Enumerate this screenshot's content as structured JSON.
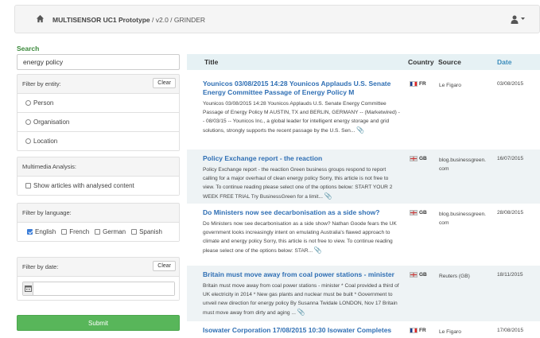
{
  "navbar": {
    "app_title": "MULTISENSOR UC1 Prototype",
    "version_path": " / v2.0 / GRINDER"
  },
  "search": {
    "label": "Search",
    "value": "energy policy",
    "submit_label": "Submit"
  },
  "filters": {
    "entity": {
      "heading": "Filter by entity:",
      "clear_label": "Clear",
      "options": [
        "Person",
        "Organisation",
        "Location"
      ]
    },
    "multimedia": {
      "heading": "Multimedia Analysis:",
      "option": "Show articles with analysed content"
    },
    "language": {
      "heading": "Filter by language:",
      "options": [
        {
          "label": "English",
          "checked": true
        },
        {
          "label": "French",
          "checked": false
        },
        {
          "label": "German",
          "checked": false
        },
        {
          "label": "Spanish",
          "checked": false
        }
      ]
    },
    "date": {
      "heading": "Filter by date:",
      "clear_label": "Clear",
      "value": ""
    }
  },
  "table": {
    "headers": {
      "title": "Title",
      "country": "Country",
      "source": "Source",
      "date": "Date"
    },
    "rows": [
      {
        "title": "Younicos 03/08/2015 14:28 Younicos Applauds U.S. Senate Energy Committee Passage of Energy Policy M",
        "snippet": "Younicos 03/08/2015 14:28 Younicos Applauds U.S. Senate Energy Committee Passage of Energy Policy M AUSTIN, TX and BERLIN, GERMANY -- (Marketwired) -- 08/03/15 -- Younicos Inc., a global leader for intelligent energy storage and grid solutions, strongly supports the recent passage by the U.S. Sen...",
        "country": "FR",
        "source": "Le Figaro",
        "date": "03/08/2015"
      },
      {
        "title": "Policy Exchange report - the reaction",
        "snippet": "Policy Exchange report - the reaction Green business groups respond to report calling for a major overhaul of clean energy policy Sorry, this article is not free to view. To continue reading please select one of the options below: START YOUR 2 WEEK FREE TRIAL Try BusinessGreen for a limit...",
        "country": "GB",
        "source": "blog.businessgreen.com",
        "date": "16/07/2015"
      },
      {
        "title": "Do Ministers now see decarbonisation as a side show?",
        "snippet": "Do Ministers now see decarbonisation as a side show? Nathan Goode fears the UK government looks increasingly intent on emulating Australia's flawed approach to climate and energy policy Sorry, this article is not free to view. To continue reading please select one of the options below: STAR...",
        "country": "GB",
        "source": "blog.businessgreen.com",
        "date": "28/08/2015"
      },
      {
        "title": "Britain must move away from coal power stations - minister",
        "snippet": "Britain must move away from coal power stations - minister * Coal provided a third of UK electricity in 2014 * New gas plants and nuclear must be built * Government to unveil new direction for energy policy By Susanna Twidale LONDON, Nov 17 Britain must move away from dirty and aging ...",
        "country": "GB",
        "source": "Reuters (GB)",
        "date": "18/11/2015"
      },
      {
        "title": "Isowater Corporation 17/08/2015 10:30 Isowater Completes",
        "snippet": "",
        "country": "FR",
        "source": "Le Figaro",
        "date": "17/08/2015"
      }
    ]
  }
}
